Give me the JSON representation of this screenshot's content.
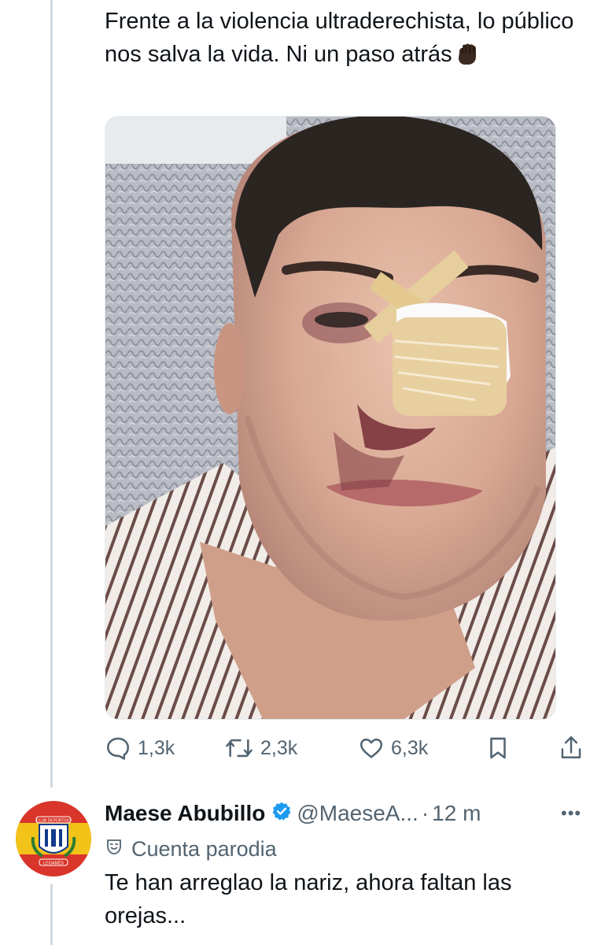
{
  "tweet": {
    "text": "Frente a la violencia ultraderechista, lo público nos salva la vida. Ni un paso atrás",
    "emoji": "raised-fist-dark-skin",
    "media": "photo-injured-man-nose-bandage"
  },
  "actions": {
    "replies": "1,3k",
    "retweets": "2,3k",
    "likes": "6,3k"
  },
  "reply": {
    "name": "Maese Abubillo",
    "handle": "@MaeseA...",
    "dot": "·",
    "time": "12 m",
    "label": "Cuenta parodia",
    "text": "Te han arreglao la nariz, ahora faltan las orejas...",
    "badge_text_top": "CLUB DEPORTIVO",
    "badge_text_bottom": "LEGANÉS"
  },
  "colors": {
    "text": "#0f1419",
    "secondary": "#536471",
    "verified": "#1d9bf0",
    "thread_line": "#cfd9de"
  }
}
